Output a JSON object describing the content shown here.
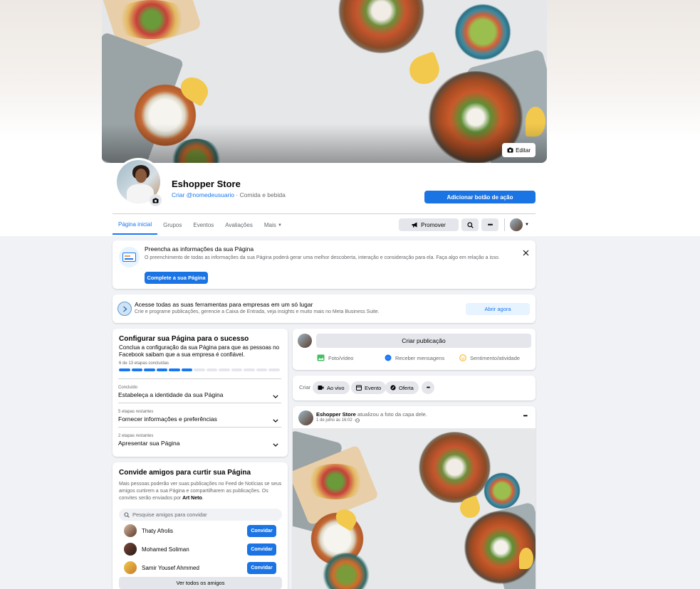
{
  "cover": {
    "edit_label": "Editar"
  },
  "page": {
    "name": "Eshopper Store",
    "username_link": "Criar @nomedeusuario",
    "category": " · Comida e bebida",
    "action_button": "Adicionar botão de ação"
  },
  "nav": {
    "tabs": [
      "Página inicial",
      "Grupos",
      "Eventos",
      "Avaliações",
      "Mais"
    ],
    "promote": "Promover"
  },
  "info_card": {
    "title": "Preencha as informações da sua Página",
    "body": "O preenchimento de todas as informações da sua Página poderá gerar uma melhor descoberta, interação e consideração para ela. Faça algo em relação a isso.",
    "button": "Complete a sua Página"
  },
  "tools_card": {
    "title": "Acesse todas as suas ferramentas para empresas em um só lugar",
    "body": "Crie e programe publicações, gerencie a Caixa de Entrada, veja insights e muito mais no Meta Business Suite.",
    "button": "Abrir agora"
  },
  "setup_card": {
    "title": "Configurar sua Página para o sucesso",
    "body": "Conclua a configuração da sua Página para que as pessoas no Facebook saibam que a sua empresa é confiável.",
    "progress_text": "6 de 13 etapas concluídas",
    "steps_done": 6,
    "steps_total": 13,
    "steps": [
      {
        "label": "Concluído",
        "title": "Estabeleça a identidade da sua Página"
      },
      {
        "label": "5 etapas restantes",
        "title": "Fornecer informações e preferências"
      },
      {
        "label": "2 etapas restantes",
        "title": "Apresentar sua Página"
      }
    ]
  },
  "invite_card": {
    "title": "Convide amigos para curtir sua Página",
    "body_pre": "Mais pessoas poderão ver suas publicações no Feed de Notícias se seus amigos curtirem a sua Página e compartilharem as publicações. Os convites serão enviados por ",
    "body_name": "Art Neto",
    "body_post": ".",
    "search_placeholder": "Pesquise amigos para convidar",
    "invite_label": "Convidar",
    "friends": [
      "Thaty Afrolis",
      "Mohamed Soliman",
      "Samir Yousef Ahmmed"
    ],
    "see_all": "Ver todos os amigos"
  },
  "composer": {
    "create_post": "Criar publicação",
    "actions": [
      "Foto/vídeo",
      "Receber mensagens",
      "Sentimento/atividade"
    ]
  },
  "create_bar": {
    "label": "Criar",
    "pills": [
      "Ao vivo",
      "Evento",
      "Oferta"
    ]
  },
  "post": {
    "author": "Eshopper Store",
    "action": " atualizou a foto da capa dele.",
    "date": "1 de julho às 16:02 · "
  },
  "colors": {
    "accent": "#1877f2",
    "button_blue": "#1b74e4",
    "background": "#f0f2f5",
    "light_button": "#e7f3ff"
  }
}
